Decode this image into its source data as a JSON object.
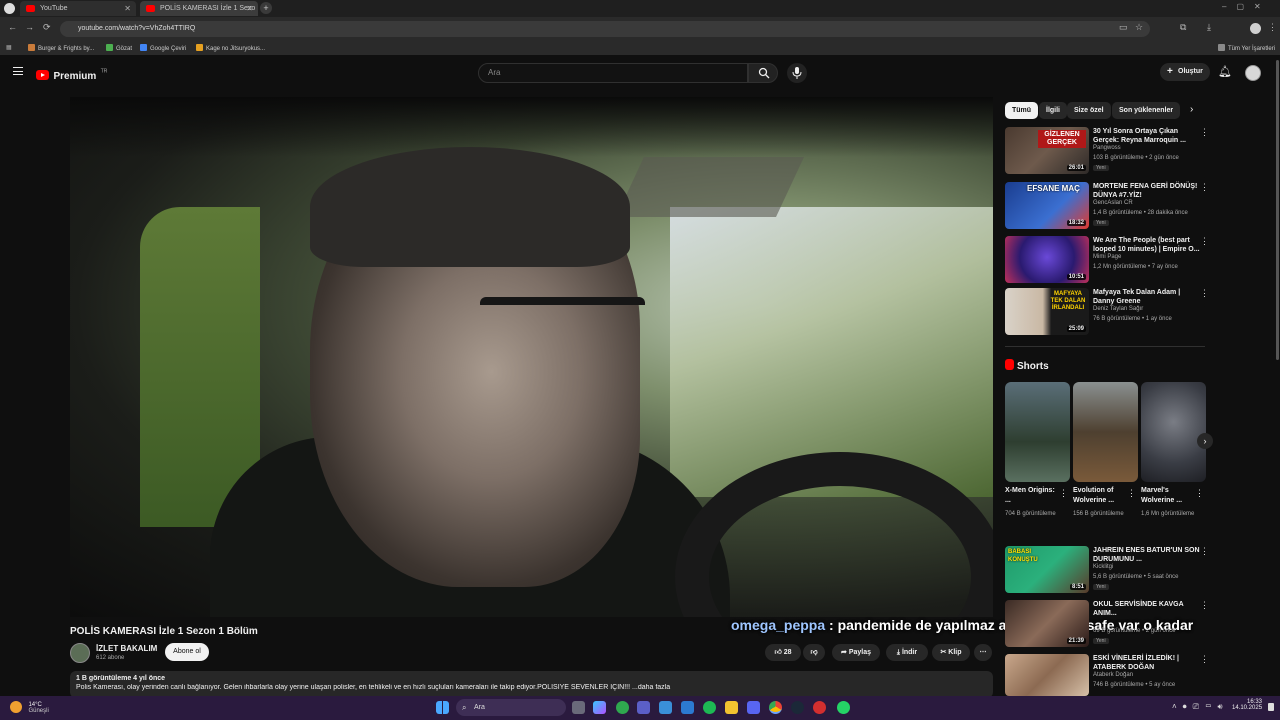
{
  "browser": {
    "tabs": [
      {
        "title": "YouTube"
      },
      {
        "title": "POLİS KAMERASI İzle 1 Sezo"
      }
    ],
    "url": "youtube.com/watch?v=VhZoh4TTIRQ",
    "bookmarks": [
      "Burger & Frights by...",
      "Gözat",
      "Google Çeviri",
      "Kage no Jitsuryokus..."
    ],
    "all_bookmarks_label": "Tüm Yer İşaretleri"
  },
  "header": {
    "logo_text": "Premium",
    "logo_sup": "TR",
    "search_placeholder": "Ara",
    "create_label": "Oluştur"
  },
  "chat_overlay": {
    "user": "omega_peppa",
    "message": " : pandemide de yapılmaz aq sosyal mesafe var o kadar"
  },
  "video": {
    "title": "POLİS KAMERASI İzle 1 Sezon 1 Bölüm",
    "channel": "İZLET BAKALIM",
    "subscribers": "612 abone",
    "subscribe_label": "Abone ol",
    "likes": "28",
    "share_label": "Paylaş",
    "download_label": "İndir",
    "clip_label": "Klip",
    "views_meta": "1 B görüntüleme  4 yıl önce",
    "description": "Polis Kamerası, olay yerinden canlı bağlanıyor. Gelen ihbarlarla olay yerine ulaşan polisler, en tehlikeli ve en hızlı suçluları kameraları ile takip ediyor.POLİSİYE SEVENLER İÇİN!!! ...daha fazla"
  },
  "chips": [
    "Tümü",
    "İlgili",
    "Size özel",
    "Son yüklenenler"
  ],
  "recommendations": [
    {
      "title": "30 Yıl Sonra Ortaya Çıkan Gerçek: Reyna Marroquin ...",
      "channel": "Pangwoss",
      "stats": "103 B görüntüleme • 2 gün önce",
      "badge": "Yeni",
      "duration": "26:01",
      "thumb_text": "GİZLENEN GERÇEK"
    },
    {
      "title": "MORTENE FENA GERİ DÖNÜŞ! DÜNYA #7.YİZ!",
      "channel": "GencAslan CR",
      "stats": "1,4 B görüntüleme • 28 dakika önce",
      "badge": "Yeni",
      "duration": "18:32",
      "thumb_text": "EFSANE MAÇ"
    },
    {
      "title": "We Are The People (best part looped 10 minutes) | Empire O...",
      "channel": "Mimi Page",
      "stats": "1,2 Mn görüntüleme • 7 ay önce",
      "badge": "",
      "duration": "10:51",
      "thumb_text": ""
    },
    {
      "title": "Mafyaya Tek Dalan Adam | Danny Greene",
      "channel": "Deniz Taylan Sağır",
      "stats": "76 B görüntüleme • 1 ay önce",
      "badge": "",
      "duration": "25:09",
      "thumb_text": "MAFYAYA TEK DALAN İRLANDALI"
    }
  ],
  "shorts": {
    "heading": "Shorts",
    "items": [
      {
        "title": "X-Men Origins: ...",
        "views": "704 B görüntüleme"
      },
      {
        "title": "Evolution of Wolverine ...",
        "views": "156 B görüntüleme"
      },
      {
        "title": "Marvel's Wolverine ...",
        "views": "1,6 Mn görüntüleme"
      }
    ]
  },
  "recommendations_lower": [
    {
      "title": "JAHREIN ENES BATUR'UN SON DURUMUNU ...",
      "channel": "Kicklitgi",
      "stats": "5,6 B görüntüleme • 5 saat önce",
      "badge": "Yeni",
      "duration": "8:51",
      "thumb_text": "BABASI KONUŞTU"
    },
    {
      "title": "OKUL SERVİSİNDE KAVGA ANIM...",
      "channel": "",
      "stats": "69 B görüntüleme • 2 gün önce",
      "badge": "Yeni",
      "duration": "21:39",
      "thumb_text": ""
    },
    {
      "title": "ESKİ VİNELERİ İZLEDİK! | ATABERK DOĞAN",
      "channel": "Ataberk Doğan",
      "stats": "746 B görüntüleme • 5 ay önce",
      "badge": "",
      "duration": "",
      "thumb_text": ""
    }
  ],
  "taskbar": {
    "weather_temp": "14°C",
    "weather_desc": "Güneşli",
    "search_label": "Ara",
    "time": "16:33",
    "date": "14.10.2025"
  }
}
